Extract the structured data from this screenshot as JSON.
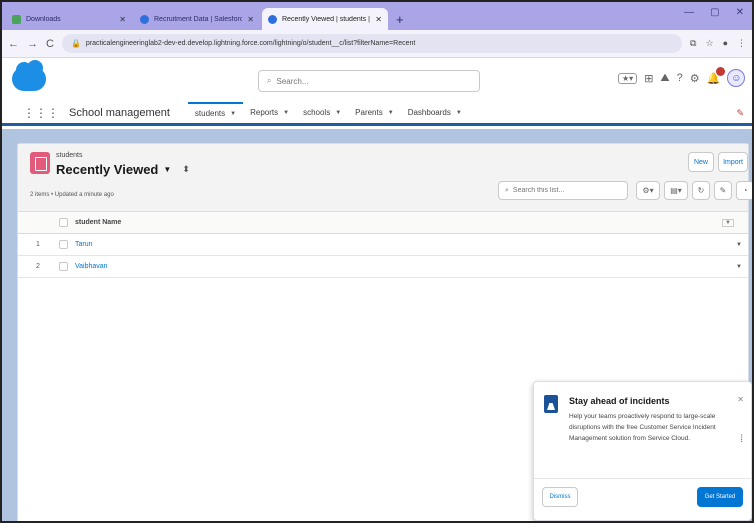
{
  "browser": {
    "tabs": [
      {
        "title": "Downloads",
        "active": false
      },
      {
        "title": "Recruitment Data | Salesforce",
        "active": false
      },
      {
        "title": "Recently Viewed | students | Salesforce",
        "active": true
      }
    ],
    "new_tab": "+",
    "window_controls": [
      "—",
      "▢",
      "✕"
    ],
    "url": "practicalengineeringlab2-dev-ed.develop.lightning.force.com/lightning/o/student__c/list?filterName=Recent"
  },
  "header": {
    "search_placeholder": "Search..."
  },
  "app_nav": {
    "app_name": "School management",
    "tabs": [
      {
        "label": "students",
        "active": true
      },
      {
        "label": "Reports",
        "active": false
      },
      {
        "label": "schools",
        "active": false
      },
      {
        "label": "Parents",
        "active": false
      },
      {
        "label": "Dashboards",
        "active": false
      }
    ]
  },
  "list_view": {
    "object_label": "students",
    "view_title": "Recently Viewed",
    "item_count": "2 items • Updated a minute ago",
    "new_button": "New",
    "import_button": "Import",
    "search_placeholder": "Search this list...",
    "column_header": "student Name",
    "rows": [
      {
        "num": "1",
        "name": "Tarun"
      },
      {
        "num": "2",
        "name": "Vaibhavan"
      }
    ]
  },
  "promo": {
    "title": "Stay ahead of incidents",
    "text": "Help your teams proactively respond to large-scale disruptions with the free Customer Service Incident Management solution from Service Cloud.",
    "dismiss": "Dismiss",
    "get_started": "Get Started"
  },
  "colors": {
    "brand_blue": "#0176d3",
    "tab_strip": "#a9a5e6",
    "workspace_bg": "#b0c4df",
    "object_icon": "#e35b7a"
  }
}
